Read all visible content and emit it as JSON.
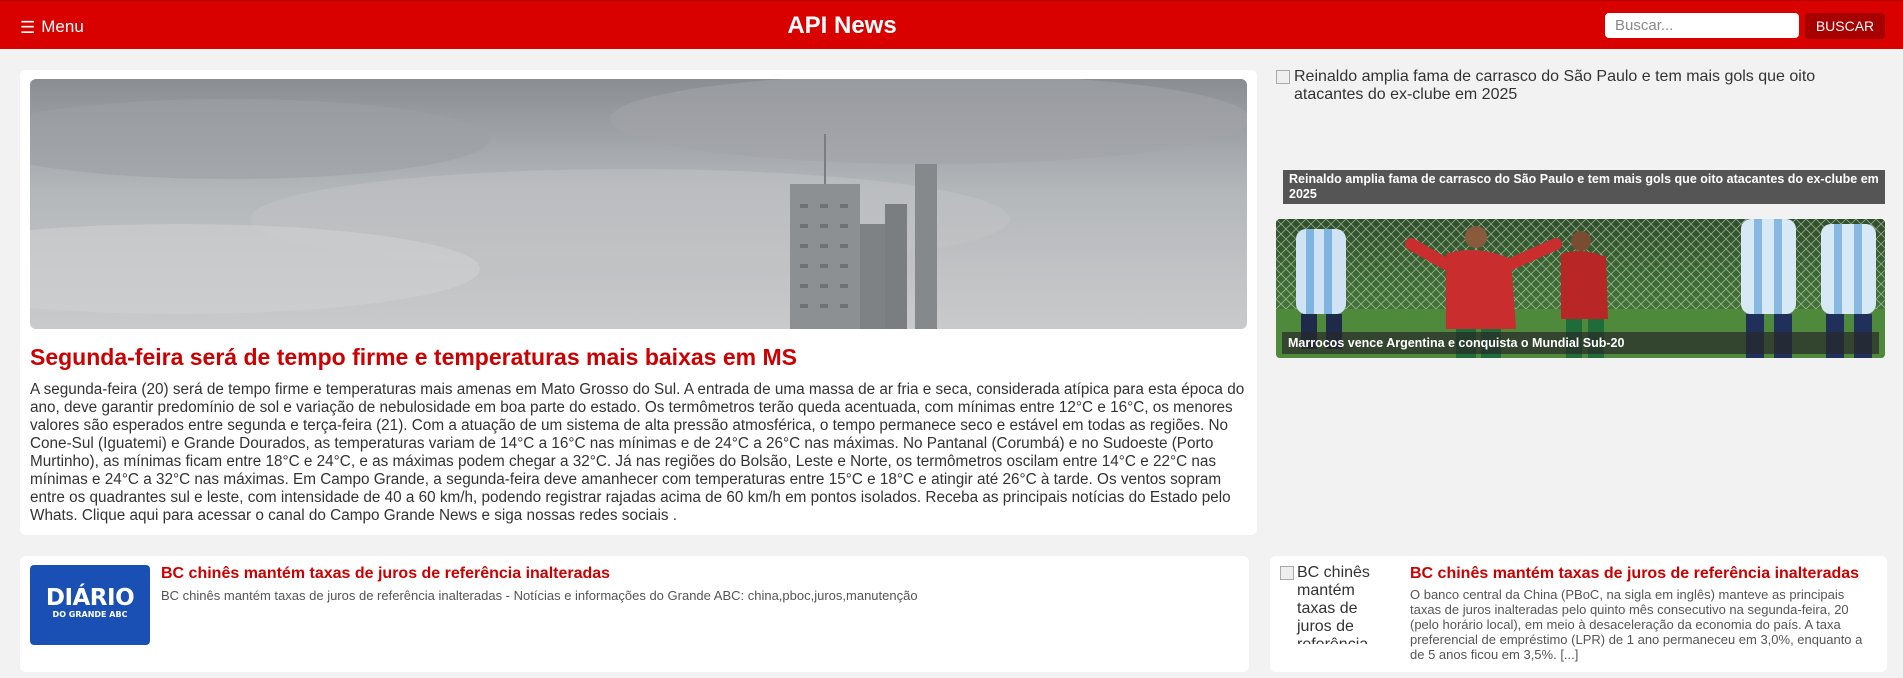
{
  "header": {
    "menu_label": "Menu",
    "menu_icon": "hamburger-icon",
    "brand": "API News",
    "search_placeholder": "Buscar...",
    "search_button": "BUSCAR",
    "colors": {
      "bar": "#d90000",
      "button": "#a70000",
      "title_red": "#cc0000"
    }
  },
  "featured": {
    "title": "Segunda-feira será de tempo firme e temperaturas mais baixas em MS",
    "body": "A segunda-feira (20) será de tempo firme e temperaturas mais amenas em Mato Grosso do Sul. A entrada de uma massa de ar fria e seca, considerada atípica para esta época do ano, deve garantir predomínio de sol e variação de nebulosidade em boa parte do estado. Os termômetros terão queda acentuada, com mínimas entre 12°C e 16°C, os menores valores são esperados entre segunda e terça-feira (21). Com a atuação de um sistema de alta pressão atmosférica, o tempo permanece seco e estável em todas as regiões. No Cone-Sul (Iguatemi) e Grande Dourados, as temperaturas variam de 14°C a 16°C nas mínimas e de 24°C a 26°C nas máximas. No Pantanal (Corumbá) e no Sudoeste (Porto Murtinho), as mínimas ficam entre 18°C e 24°C, e as máximas podem chegar a 32°C. Já nas regiões do Bolsão, Leste e Norte, os termômetros oscilam entre 14°C e 22°C nas mínimas e 24°C a 32°C nas máximas. Em Campo Grande, a segunda-feira deve amanhecer com temperaturas entre 15°C e 18°C e atingir até 26°C à tarde. Os ventos sopram entre os quadrantes sul e leste, com intensidade de 40 a 60 km/h, podendo registrar rajadas acima de 60 km/h em pontos isolados. Receba as principais notícias do Estado pelo Whats. Clique aqui para acessar o canal do Campo Grande News e siga nossas redes sociais ."
  },
  "sidebar": {
    "broken_image_alt": "Reinaldo amplia fama de carrasco do São Paulo e tem mais gols que oito atacantes do ex-clube em 2025",
    "broken_image_caption": "Reinaldo amplia fama de carrasco do São Paulo e tem mais gols que oito atacantes do ex-clube em 2025",
    "tile_caption": "Marrocos vence Argentina e conquista o Mundial Sub-20"
  },
  "cards": [
    {
      "logo_main": "DIÁRIO",
      "logo_sub": "DO GRANDE ABC",
      "title": "BC chinês mantém taxas de juros de referência inalteradas",
      "desc": "BC chinês mantém taxas de juros de referência inalteradas - Notícias e informações do Grande ABC: china,pboc,juros,manutenção"
    },
    {
      "image_alt": "BC chinês mantém taxas de juros de referência inalteradas",
      "title": "BC chinês mantém taxas de juros de referência inalteradas",
      "desc": "O banco central da China (PBoC, na sigla em inglês) manteve as principais taxas de juros inalteradas pelo quinto mês consecutivo na segunda-feira, 20 (pelo horário local), em meio à desaceleração da economia do país. A taxa preferencial de empréstimo (LPR) de 1 ano permaneceu em 3,0%, enquanto a de 5 anos ficou em 3,5%. [...]"
    }
  ]
}
